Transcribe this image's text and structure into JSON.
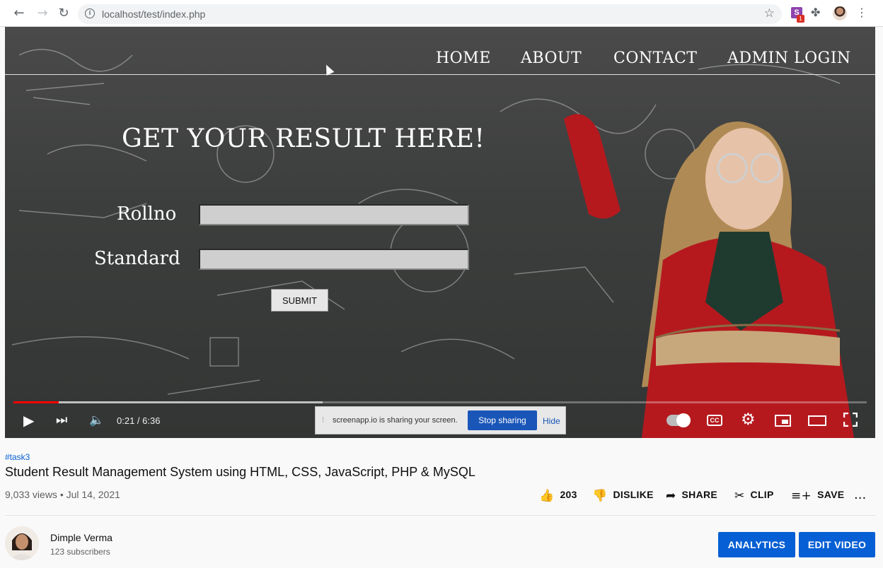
{
  "browser": {
    "url": "localhost/test/index.php",
    "ext_badge": "1",
    "ext_letter": "S"
  },
  "site": {
    "nav": [
      "HOME",
      "ABOUT",
      "CONTACT",
      "ADMIN LOGIN"
    ],
    "hero_title": "GET YOUR RESULT HERE!",
    "rollno_label": "Rollno",
    "standard_label": "Standard",
    "submit_label": "SUBMIT"
  },
  "player": {
    "time": "0:21 / 6:36",
    "progress_played_fraction": 0.053,
    "progress_buffered_fraction": 0.362,
    "share_message": "screenapp.io is sharing your screen.",
    "stop_sharing": "Stop sharing",
    "hide": "Hide"
  },
  "video": {
    "hashtag": "#task3",
    "title": "Student Result Management System using HTML, CSS, JavaScript, PHP & MySQL",
    "meta": "9,033 views • Jul 14, 2021",
    "likes": "203",
    "dislike": "DISLIKE",
    "share": "SHARE",
    "clip": "CLIP",
    "save": "SAVE",
    "more": "..."
  },
  "channel": {
    "name": "Dimple Verma",
    "subscribers": "123 subscribers",
    "analytics": "ANALYTICS",
    "edit_video": "EDIT VIDEO"
  },
  "colors": {
    "accent_blue": "#065fd4",
    "progress_red": "#ff0000",
    "share_blue": "#1a56b8"
  }
}
